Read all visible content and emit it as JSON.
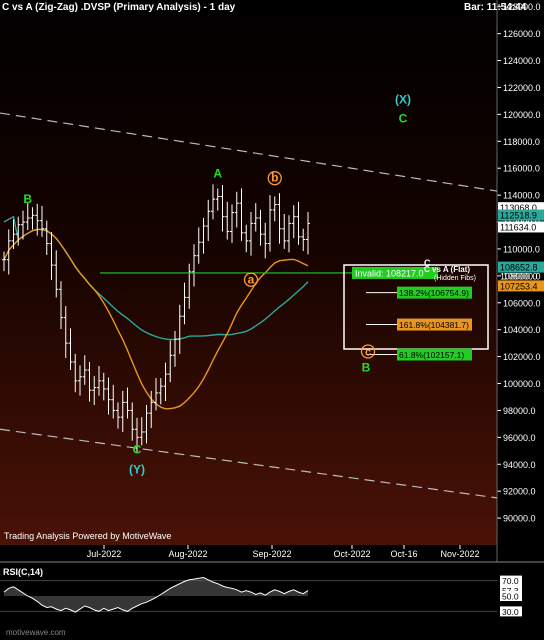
{
  "header": {
    "title": "C vs A (Zig-Zag) .DVSP (Primary Analysis) - 1 day",
    "bar_time": "Bar: 11:54:44"
  },
  "credit": "Trading Analysis Powered by MotiveWave",
  "watermark": "motivewave.com",
  "colors": {
    "background_top": "#000000",
    "background_bottom": "#4a1206",
    "bars": "#ffffff",
    "wave_green": "#22dd22",
    "wave_orange": "#ff9933",
    "wave_cyan": "#33cccc",
    "ma_orange": "#e8961e",
    "ma_teal": "#2aa89a",
    "invalid_green": "#22cc22"
  },
  "chart_data": {
    "type": "ohlc",
    "ylim": [
      88000,
      128500
    ],
    "y_ticks": [
      90000,
      92000,
      94000,
      96000,
      98000,
      100000,
      102000,
      104000,
      106000,
      108000,
      110000,
      112000,
      114000,
      116000,
      118000,
      120000,
      122000,
      124000,
      126000,
      128000
    ],
    "x_labels": [
      "Jul-2022",
      "Aug-2022",
      "Sep-2022",
      "Oct-2022",
      "Oct-16",
      "Nov-2022"
    ],
    "closes": [
      109200,
      110600,
      111100,
      111800,
      112000,
      112300,
      112500,
      112100,
      111500,
      110400,
      108800,
      107000,
      104900,
      103000,
      101600,
      100200,
      100500,
      101000,
      99500,
      99700,
      100200,
      99600,
      98800,
      98000,
      97500,
      98600,
      98000,
      96600,
      96000,
      96400,
      97800,
      98600,
      99300,
      99800,
      100700,
      102100,
      103300,
      105000,
      106400,
      108300,
      109500,
      110500,
      111700,
      112800,
      113700,
      113900,
      112400,
      111300,
      112700,
      113400,
      111200,
      110600,
      111900,
      112300,
      111100,
      110400,
      112900,
      113300,
      111500,
      110600,
      111900,
      112400,
      110900,
      110700,
      111900
    ],
    "wave_labels": [
      {
        "text": "B",
        "idx": 5,
        "price": 113400,
        "color": "green"
      },
      {
        "text": "A",
        "idx": 45,
        "price": 115300,
        "color": "green"
      },
      {
        "text": "b",
        "idx": 57,
        "price": 115000,
        "color": "orange",
        "circle": true
      },
      {
        "text": "a",
        "idx": 52,
        "price": 107450,
        "color": "orange",
        "circle": true
      },
      {
        "text": "C",
        "idx": 28,
        "price": 94800,
        "color": "green"
      },
      {
        "text": "(Y)",
        "idx": 28,
        "price": 93300,
        "color": "cyan"
      },
      {
        "text": "(X)",
        "idx": 84,
        "price": 120800,
        "color": "cyan"
      },
      {
        "text": "C",
        "idx": 84,
        "price": 119400,
        "color": "green"
      }
    ],
    "price_tags": [
      {
        "label": "113068.0",
        "price": 113068,
        "bg": "#ffffff",
        "fg": "#000"
      },
      {
        "label": "112518.9",
        "price": 112519,
        "bg": "#2aa89a",
        "fg": "#000"
      },
      {
        "label": "111634.0",
        "price": 111634,
        "bg": "#ffffff",
        "fg": "#000"
      },
      {
        "label": "108652.8",
        "price": 108653,
        "bg": "#2aa89a",
        "fg": "#000"
      },
      {
        "label": "108000.0",
        "price": 108000,
        "bg": "none",
        "fg": "#fff"
      },
      {
        "label": "107253.4",
        "price": 107253,
        "bg": "#e8961e",
        "fg": "#000"
      }
    ],
    "invalid_line": {
      "label": "Invalid: 108217.0",
      "price": 108217
    },
    "projection_box": {
      "title": "C vs A (Flat)",
      "subtitle": "(Hidden Fibs)",
      "label_C": "C",
      "label_B": "B",
      "label_c": "c",
      "levels": [
        {
          "label": "138.2%(106754.9)",
          "price": 106755,
          "bg": "#22cc22"
        },
        {
          "label": "161.8%(104381.7)",
          "price": 104382,
          "bg": "#e8961e"
        },
        {
          "label": "61.8%(102157.1)",
          "price": 102157,
          "bg": "#22cc22"
        }
      ]
    }
  },
  "rsi": {
    "label": "RSI(C,14)",
    "levels": [
      {
        "label": "70.0",
        "value": 70,
        "bg": "#ffffff"
      },
      {
        "label": "57.3",
        "value": 57.3,
        "bg": "#ffffff"
      },
      {
        "label": "50.0",
        "value": 50,
        "bg": "#ffffff"
      },
      {
        "label": "30.0",
        "value": 30,
        "bg": "#ffffff"
      }
    ],
    "values": [
      55,
      60,
      62,
      58,
      54,
      50,
      47,
      43,
      38,
      35,
      36,
      33,
      31,
      34,
      32,
      29,
      33,
      37,
      35,
      32,
      30,
      34,
      31,
      33,
      35,
      32,
      30,
      34,
      37,
      40,
      42,
      45,
      48,
      52,
      56,
      60,
      63,
      66,
      69,
      71,
      72,
      73,
      74,
      71,
      68,
      66,
      63,
      61,
      60,
      58,
      55,
      57,
      55,
      52,
      54,
      51,
      55,
      58,
      56,
      53,
      56,
      58,
      55,
      53,
      57
    ]
  }
}
